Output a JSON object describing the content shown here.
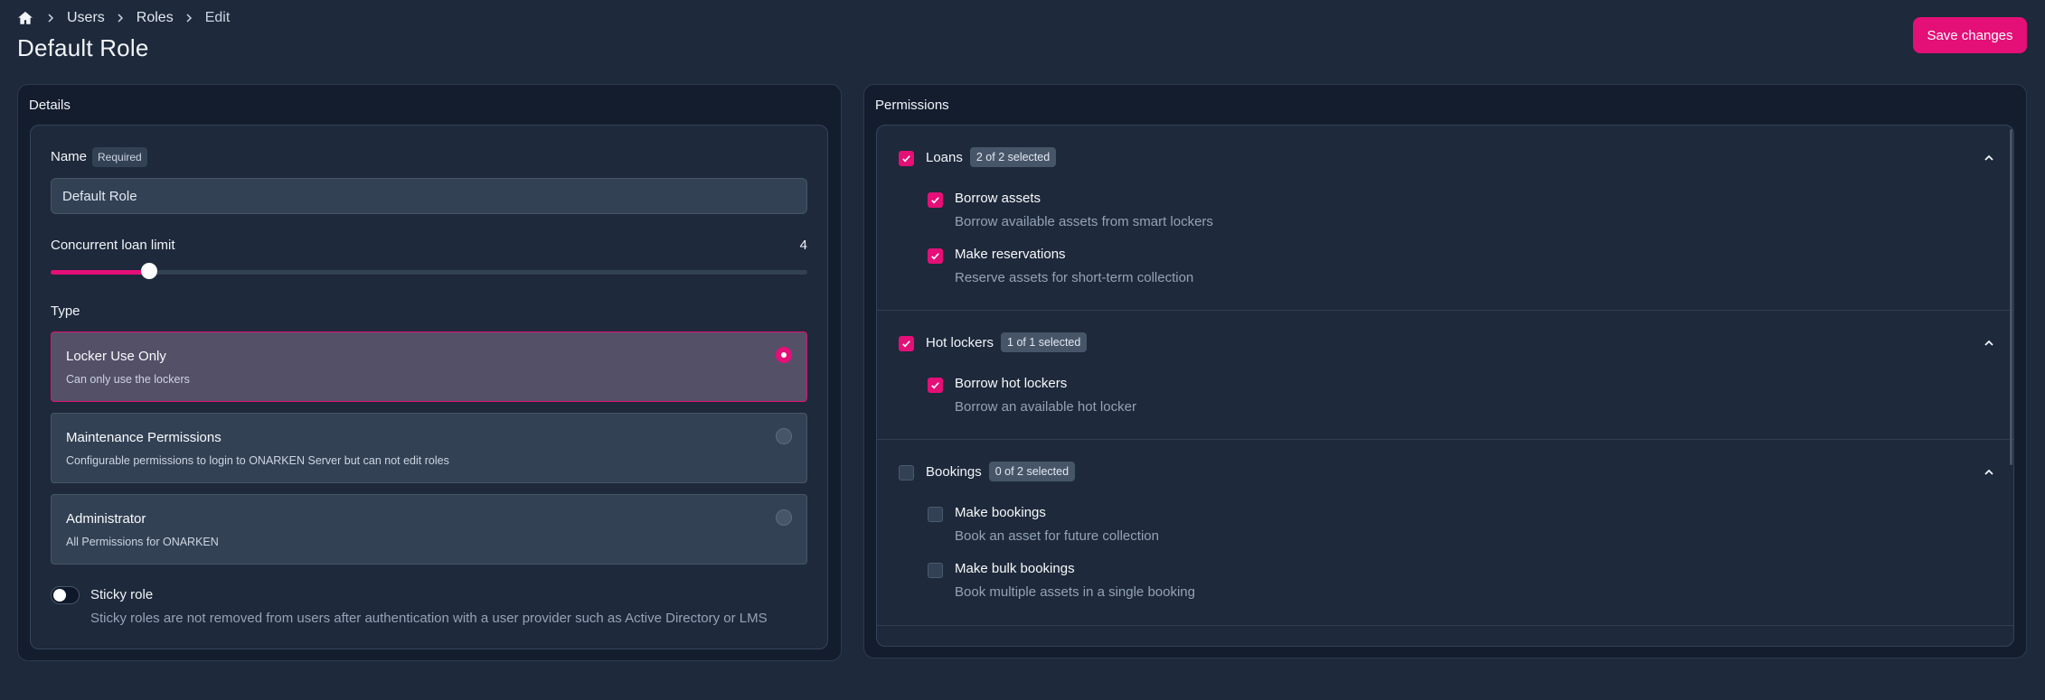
{
  "breadcrumb": {
    "items": [
      "Users",
      "Roles",
      "Edit"
    ]
  },
  "page": {
    "title": "Default Role",
    "save_label": "Save changes"
  },
  "details": {
    "title": "Details",
    "name_label": "Name",
    "required_badge": "Required",
    "name_value": "Default Role",
    "loan_limit_label": "Concurrent loan limit",
    "loan_limit_value": "4",
    "loan_limit_fraction": 0.13,
    "type_label": "Type",
    "types": [
      {
        "title": "Locker Use Only",
        "desc": "Can only use the lockers",
        "selected": true
      },
      {
        "title": "Maintenance Permissions",
        "desc": "Configurable permissions to login to ONARKEN Server but can not edit roles",
        "selected": false
      },
      {
        "title": "Administrator",
        "desc": "All Permissions for ONARKEN",
        "selected": false
      }
    ],
    "sticky_title": "Sticky role",
    "sticky_desc": "Sticky roles are not removed from users after authentication with a user provider such as Active Directory or LMS",
    "sticky_enabled": false
  },
  "permissions": {
    "title": "Permissions",
    "groups": [
      {
        "name": "Loans",
        "badge": "2 of 2 selected",
        "checked": true,
        "items": [
          {
            "title": "Borrow assets",
            "desc": "Borrow available assets from smart lockers",
            "checked": true
          },
          {
            "title": "Make reservations",
            "desc": "Reserve assets for short-term collection",
            "checked": true
          }
        ]
      },
      {
        "name": "Hot lockers",
        "badge": "1 of 1 selected",
        "checked": true,
        "items": [
          {
            "title": "Borrow hot lockers",
            "desc": "Borrow an available hot locker",
            "checked": true
          }
        ]
      },
      {
        "name": "Bookings",
        "badge": "0 of 2 selected",
        "checked": false,
        "items": [
          {
            "title": "Make bookings",
            "desc": "Book an asset for future collection",
            "checked": false
          },
          {
            "title": "Make bulk bookings",
            "desc": "Book multiple assets in a single booking",
            "checked": false
          }
        ]
      }
    ]
  },
  "colors": {
    "accent": "#e40f77",
    "background": "#1e293b",
    "panel": "#141d2e"
  }
}
